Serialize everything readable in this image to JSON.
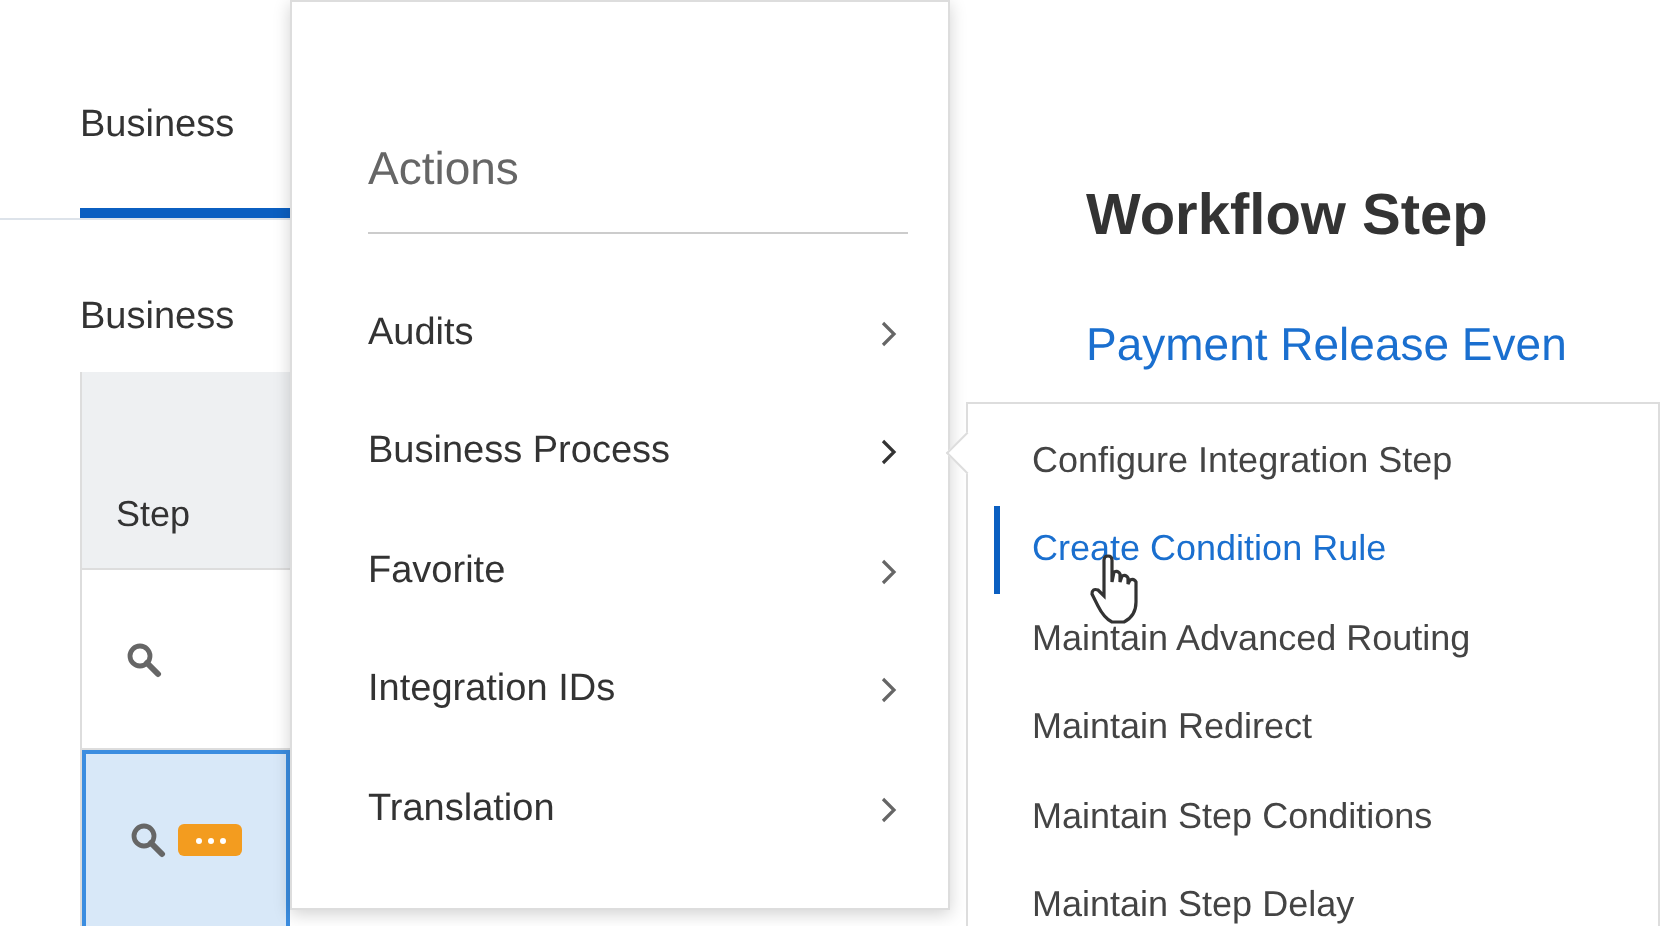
{
  "tab": {
    "label": "Business ",
    "selected": true
  },
  "section_label": "Business ",
  "table": {
    "columns": [
      "Step"
    ],
    "rows": [
      {
        "selected": false,
        "actions": false
      },
      {
        "selected": true,
        "actions": true
      }
    ]
  },
  "detail": {
    "title": "Workflow Step",
    "link": "Payment Release Even"
  },
  "actions_menu": {
    "title": "Actions",
    "items": [
      {
        "label": "Audits",
        "expanded": false
      },
      {
        "label": "Business Process",
        "expanded": true
      },
      {
        "label": "Favorite",
        "expanded": false
      },
      {
        "label": "Integration IDs",
        "expanded": false
      },
      {
        "label": "Translation",
        "expanded": false
      }
    ]
  },
  "submenu": {
    "items": [
      {
        "label": "Configure Integration Step",
        "selected": false
      },
      {
        "label": "Create Condition Rule",
        "selected": true
      },
      {
        "label": "Maintain Advanced Routing",
        "selected": false
      },
      {
        "label": "Maintain Redirect",
        "selected": false
      },
      {
        "label": "Maintain Step Conditions",
        "selected": false
      },
      {
        "label": "Maintain Step Delay",
        "selected": false
      }
    ]
  }
}
